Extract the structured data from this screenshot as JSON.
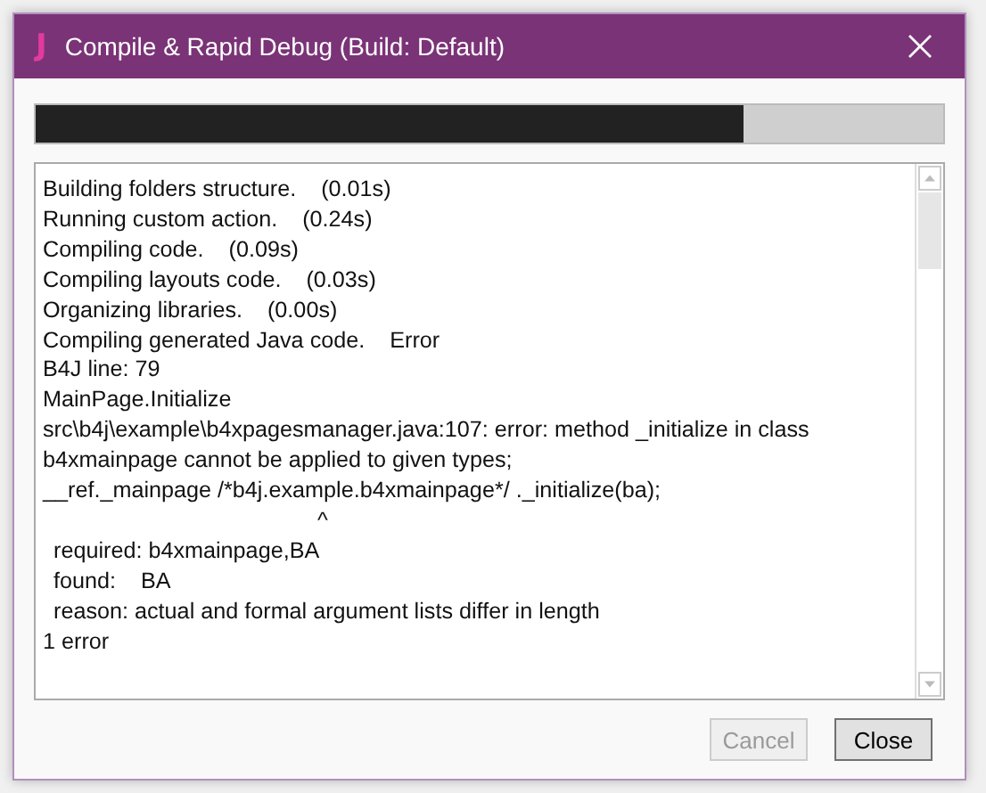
{
  "window": {
    "title": "Compile & Rapid Debug (Build: Default)",
    "app_letter": "J"
  },
  "progress": {
    "level": 0.78
  },
  "log": [
    {
      "kind": "plain",
      "text": "Building folders structure.    (0.01s)"
    },
    {
      "kind": "plain",
      "text": "Running custom action.    (0.24s)"
    },
    {
      "kind": "plain",
      "text": "Compiling code.    (0.09s)"
    },
    {
      "kind": "plain",
      "text": "Compiling layouts code.    (0.03s)"
    },
    {
      "kind": "plain",
      "text": "Organizing libraries.    (0.00s)"
    },
    {
      "kind": "plain",
      "text": "Compiling generated Java code.    Error"
    },
    {
      "kind": "plain",
      "text": "B4J line: 79"
    },
    {
      "kind": "plain",
      "text": "MainPage.Initialize"
    },
    {
      "kind": "plain",
      "text": "src\\b4j\\example\\b4xpagesmanager.java:107: error: method _initialize in class"
    },
    {
      "kind": "plain",
      "text": "b4xmainpage cannot be applied to given types;"
    },
    {
      "kind": "plain",
      "text": "__ref._mainpage /*b4j.example.b4xmainpage*/ ._initialize(ba);"
    },
    {
      "kind": "caret",
      "text": "^"
    },
    {
      "kind": "indented",
      "text": "required: b4xmainpage,BA"
    },
    {
      "kind": "indented",
      "text": "found:    BA"
    },
    {
      "kind": "indented",
      "text": "reason: actual and formal argument lists differ in length"
    },
    {
      "kind": "plain",
      "text": "1 error"
    }
  ],
  "buttons": [
    {
      "label": "Cancel",
      "disabled": true
    },
    {
      "label": "Close",
      "disabled": false
    }
  ]
}
